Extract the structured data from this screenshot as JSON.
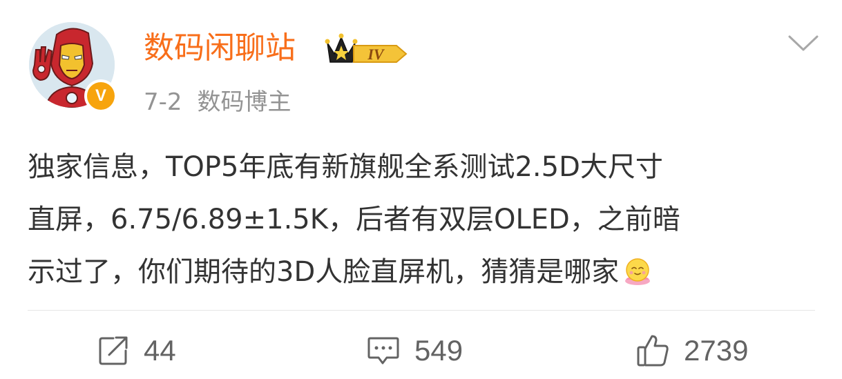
{
  "post": {
    "author": {
      "name": "数码闲聊站",
      "level_badge": "IV",
      "avatar_icon": "iron-man-avatar",
      "verified_badge": "V",
      "verified_color": "#f7a40d"
    },
    "date": "7-2",
    "source": "数码博主",
    "content_lines": [
      "独家信息，TOP5年底有新旗舰全系测试2.5D大尺寸",
      "直屏，6.75/6.89±1.5K，后者有双层OLED，之前暗",
      "示过了，你们期待的3D人脸直屏机，猜猜是哪家"
    ],
    "emoji": "smiling-face-emoji",
    "stats": {
      "reposts": "44",
      "comments": "549",
      "likes": "2739"
    }
  },
  "colors": {
    "username": "#f86e1a",
    "text": "#333333",
    "meta": "#939393",
    "icons": "#636363"
  }
}
